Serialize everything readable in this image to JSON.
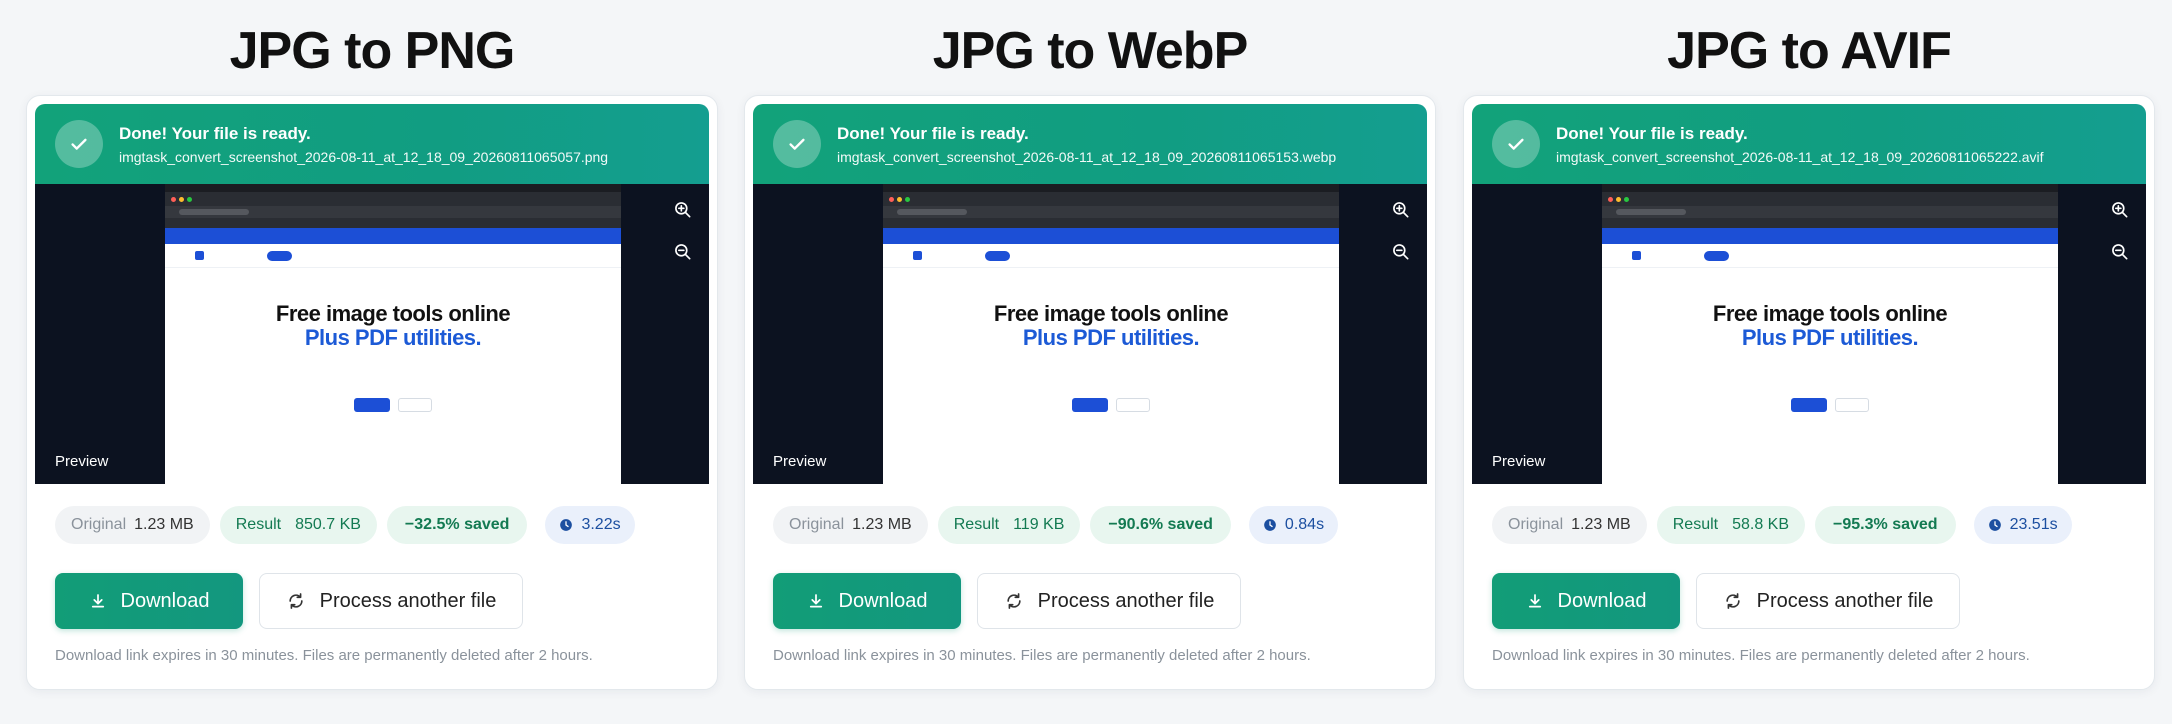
{
  "colors": {
    "accent": "#12a27a",
    "blue": "#1c4fd6",
    "page_bg": "#f4f6f8"
  },
  "common": {
    "banner_title": "Done! Your file is ready.",
    "preview_label": "Preview",
    "original_label": "Original",
    "result_label": "Result",
    "download_label": "Download",
    "process_label": "Process another file",
    "footnote": "Download link expires in 30 minutes. Files are permanently deleted after 2 hours.",
    "icons": {
      "check": "check-icon",
      "zoom_in": "zoom-in-icon",
      "zoom_out": "zoom-out-icon",
      "clock": "clock-icon",
      "download": "download-icon",
      "refresh": "refresh-icon"
    }
  },
  "preview_screenshot": {
    "hero_line1": "Free image tools online",
    "hero_line2": "Plus PDF utilities."
  },
  "conversions": [
    {
      "title": "JPG to PNG",
      "filename": "imgtask_convert_screenshot_2026-08-11_at_12_18_09_20260811065057.png",
      "original_size": "1.23 MB",
      "result_size": "850.7 KB",
      "saved": "−32.5% saved",
      "time": "3.22s"
    },
    {
      "title": "JPG to WebP",
      "filename": "imgtask_convert_screenshot_2026-08-11_at_12_18_09_20260811065153.webp",
      "original_size": "1.23 MB",
      "result_size": "119 KB",
      "saved": "−90.6% saved",
      "time": "0.84s"
    },
    {
      "title": "JPG to AVIF",
      "filename": "imgtask_convert_screenshot_2026-08-11_at_12_18_09_20260811065222.avif",
      "original_size": "1.23 MB",
      "result_size": "58.8 KB",
      "saved": "−95.3% saved",
      "time": "23.51s"
    }
  ]
}
